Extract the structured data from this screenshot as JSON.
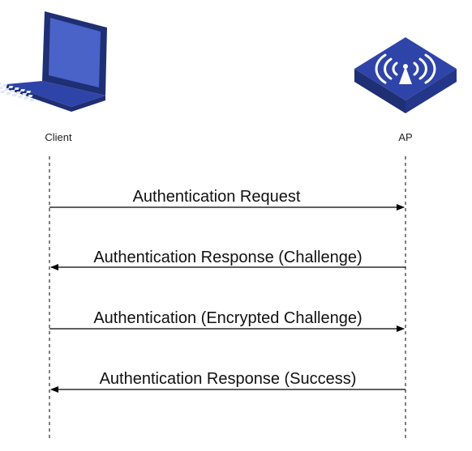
{
  "actors": {
    "client": {
      "label": "Client",
      "icon": "laptop-icon"
    },
    "ap": {
      "label": "AP",
      "icon": "access-point-icon"
    }
  },
  "messages": [
    {
      "label": "Authentication Request",
      "from": "client",
      "to": "ap"
    },
    {
      "label": "Authentication Response (Challenge)",
      "from": "ap",
      "to": "client"
    },
    {
      "label": "Authentication (Encrypted Challenge)",
      "from": "client",
      "to": "ap"
    },
    {
      "label": "Authentication Response (Success)",
      "from": "ap",
      "to": "client"
    }
  ],
  "colors": {
    "icon_dark": "#1f2f74",
    "icon_mid": "#2f44a8",
    "icon_light": "#4a63c8",
    "screen": "#5a6fd0"
  }
}
